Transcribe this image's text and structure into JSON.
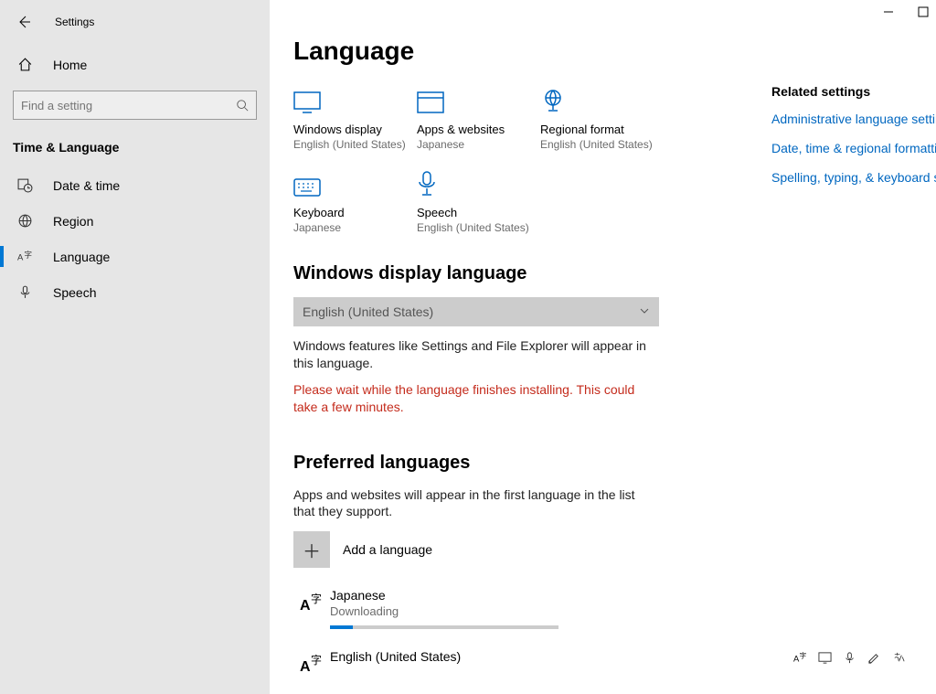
{
  "header": {
    "app_title": "Settings"
  },
  "sidebar": {
    "home_label": "Home",
    "search_placeholder": "Find a setting",
    "category": "Time & Language",
    "items": [
      {
        "label": "Date & time"
      },
      {
        "label": "Region"
      },
      {
        "label": "Language"
      },
      {
        "label": "Speech"
      }
    ]
  },
  "page": {
    "title": "Language",
    "tiles": [
      {
        "heading": "Windows display",
        "sub": "English (United States)"
      },
      {
        "heading": "Apps & websites",
        "sub": "Japanese"
      },
      {
        "heading": "Regional format",
        "sub": "English (United States)"
      },
      {
        "heading": "Keyboard",
        "sub": "Japanese"
      },
      {
        "heading": "Speech",
        "sub": "English (United States)"
      }
    ],
    "display_section": {
      "heading": "Windows display language",
      "selected": "English (United States)",
      "description": "Windows features like Settings and File Explorer will appear in this language.",
      "warning": "Please wait while the language finishes installing. This could take a few minutes."
    },
    "preferred_section": {
      "heading": "Preferred languages",
      "description": "Apps and websites will appear in the first language in the list that they support.",
      "add_label": "Add a language",
      "languages": [
        {
          "name": "Japanese",
          "status": "Downloading"
        },
        {
          "name": "English (United States)"
        }
      ]
    }
  },
  "aside": {
    "heading": "Related settings",
    "links": [
      "Administrative language settings",
      "Date, time & regional formatting",
      "Spelling, typing, & keyboard settings"
    ]
  }
}
